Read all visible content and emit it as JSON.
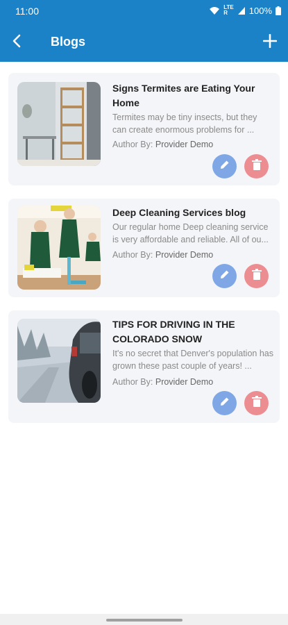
{
  "status_bar": {
    "time": "11:00",
    "battery": "100%",
    "icons": [
      "wifi-icon",
      "lte-icon",
      "signal-icon",
      "battery-icon"
    ]
  },
  "app_bar": {
    "title": "Blogs",
    "back_icon": "chevron-left-icon",
    "add_icon": "plus-icon",
    "color": "#1b82c8"
  },
  "blogs": [
    {
      "title": "Signs Termites are Eating Your Home",
      "excerpt": "Termites may be tiny insects, but they can create enormous problems for ...",
      "author_label": "Author By:",
      "author_name": "Provider Demo"
    },
    {
      "title": "Deep Cleaning Services blog",
      "excerpt": "Our regular home Deep cleaning service is very affordable and reliable. All of ou...",
      "author_label": "Author By:",
      "author_name": "Provider Demo"
    },
    {
      "title": "TIPS FOR DRIVING IN THE COLORADO SNOW",
      "excerpt": "It's no secret that Denver's population has grown these past couple of years! ...",
      "author_label": "Author By:",
      "author_name": "Provider Demo"
    }
  ],
  "colors": {
    "edit_button": "#7fa7e6",
    "delete_button": "#ec8d91",
    "card_background": "#f4f5f8"
  }
}
